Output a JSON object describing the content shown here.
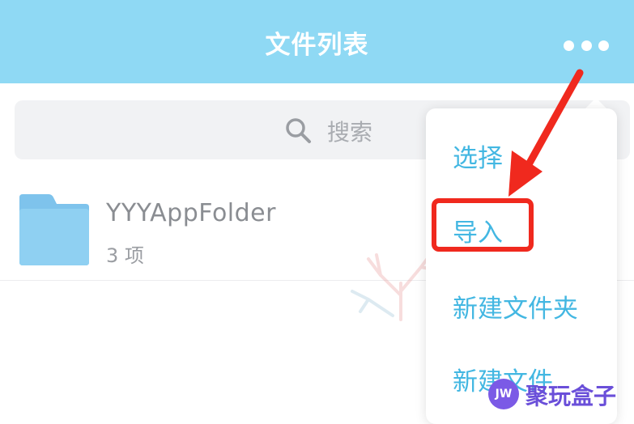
{
  "header": {
    "title": "文件列表",
    "more_icon": "more-horizontal-icon",
    "background_color": "#8fd9f4"
  },
  "search": {
    "placeholder": "搜索",
    "icon": "search-icon"
  },
  "files": [
    {
      "name": "YYYAppFolder",
      "count": "3 项",
      "icon": "folder-icon"
    }
  ],
  "menu": {
    "items": [
      {
        "label": "选择"
      },
      {
        "label": "导入"
      },
      {
        "label": "新建文件夹"
      },
      {
        "label": "新建文件"
      }
    ],
    "highlighted_item": "导入",
    "text_color": "#43b7e2"
  },
  "annotation": {
    "highlight_color": "#f0291e",
    "arrow_icon": "red-arrow-icon"
  },
  "watermark": {
    "badge": "JW",
    "text": "聚玩盒子",
    "color": "#6a4fd9"
  }
}
